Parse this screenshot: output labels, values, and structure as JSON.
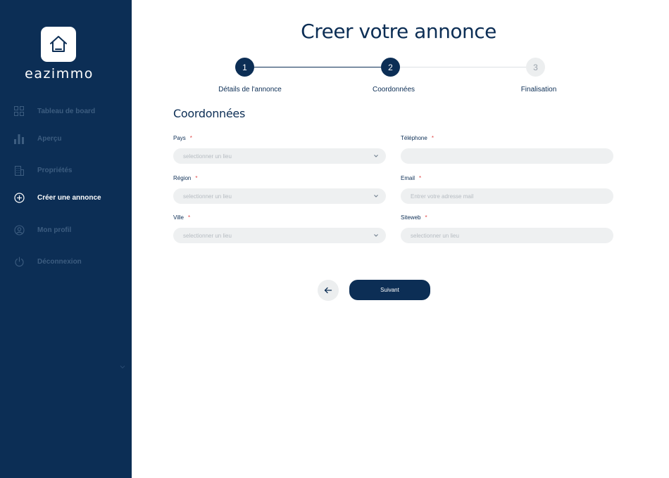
{
  "brand": {
    "name": "eazimmo"
  },
  "sidebar": {
    "items": [
      {
        "label": "Tableau de board",
        "icon": "grid-icon",
        "active": false
      },
      {
        "label": "Aperçu",
        "icon": "bar-chart-icon",
        "active": false
      },
      {
        "label": "Propriétés",
        "icon": "building-icon",
        "active": false
      },
      {
        "label": "Créer une annonce",
        "icon": "plus-circle-icon",
        "active": true
      },
      {
        "label": "Mon profil",
        "icon": "user-circle-icon",
        "active": false
      },
      {
        "label": "Déconnexion",
        "icon": "power-icon",
        "active": false
      }
    ]
  },
  "page": {
    "title": "Creer votre  annonce"
  },
  "stepper": {
    "current_step": 2,
    "steps": [
      {
        "number": "1",
        "label": "Détails de l'annonce"
      },
      {
        "number": "2",
        "label": "Coordonnées"
      },
      {
        "number": "3",
        "label": "Finalisation"
      }
    ]
  },
  "form": {
    "section_title": "Coordonnées",
    "required_mark": "*",
    "fields": {
      "pays": {
        "label": "Pays",
        "placeholder": "selectionner un lieu"
      },
      "region": {
        "label": "Région",
        "placeholder": "selectionner un lieu"
      },
      "ville": {
        "label": "Ville",
        "placeholder": "selectionner un lieu"
      },
      "telephone": {
        "label": "Téléphone",
        "placeholder": ""
      },
      "email": {
        "label": "Email",
        "placeholder": "Entrer votre adresse mail"
      },
      "siteweb": {
        "label": "Siteweb",
        "placeholder": "selectionner un lieu"
      }
    }
  },
  "actions": {
    "next_label": "Suivant"
  },
  "colors": {
    "sidebar_bg": "#0c2e55",
    "primary": "#0c2e55",
    "field_bg": "#eef0f1",
    "required": "#e04848",
    "inactive_nav": "#3d5d80"
  }
}
